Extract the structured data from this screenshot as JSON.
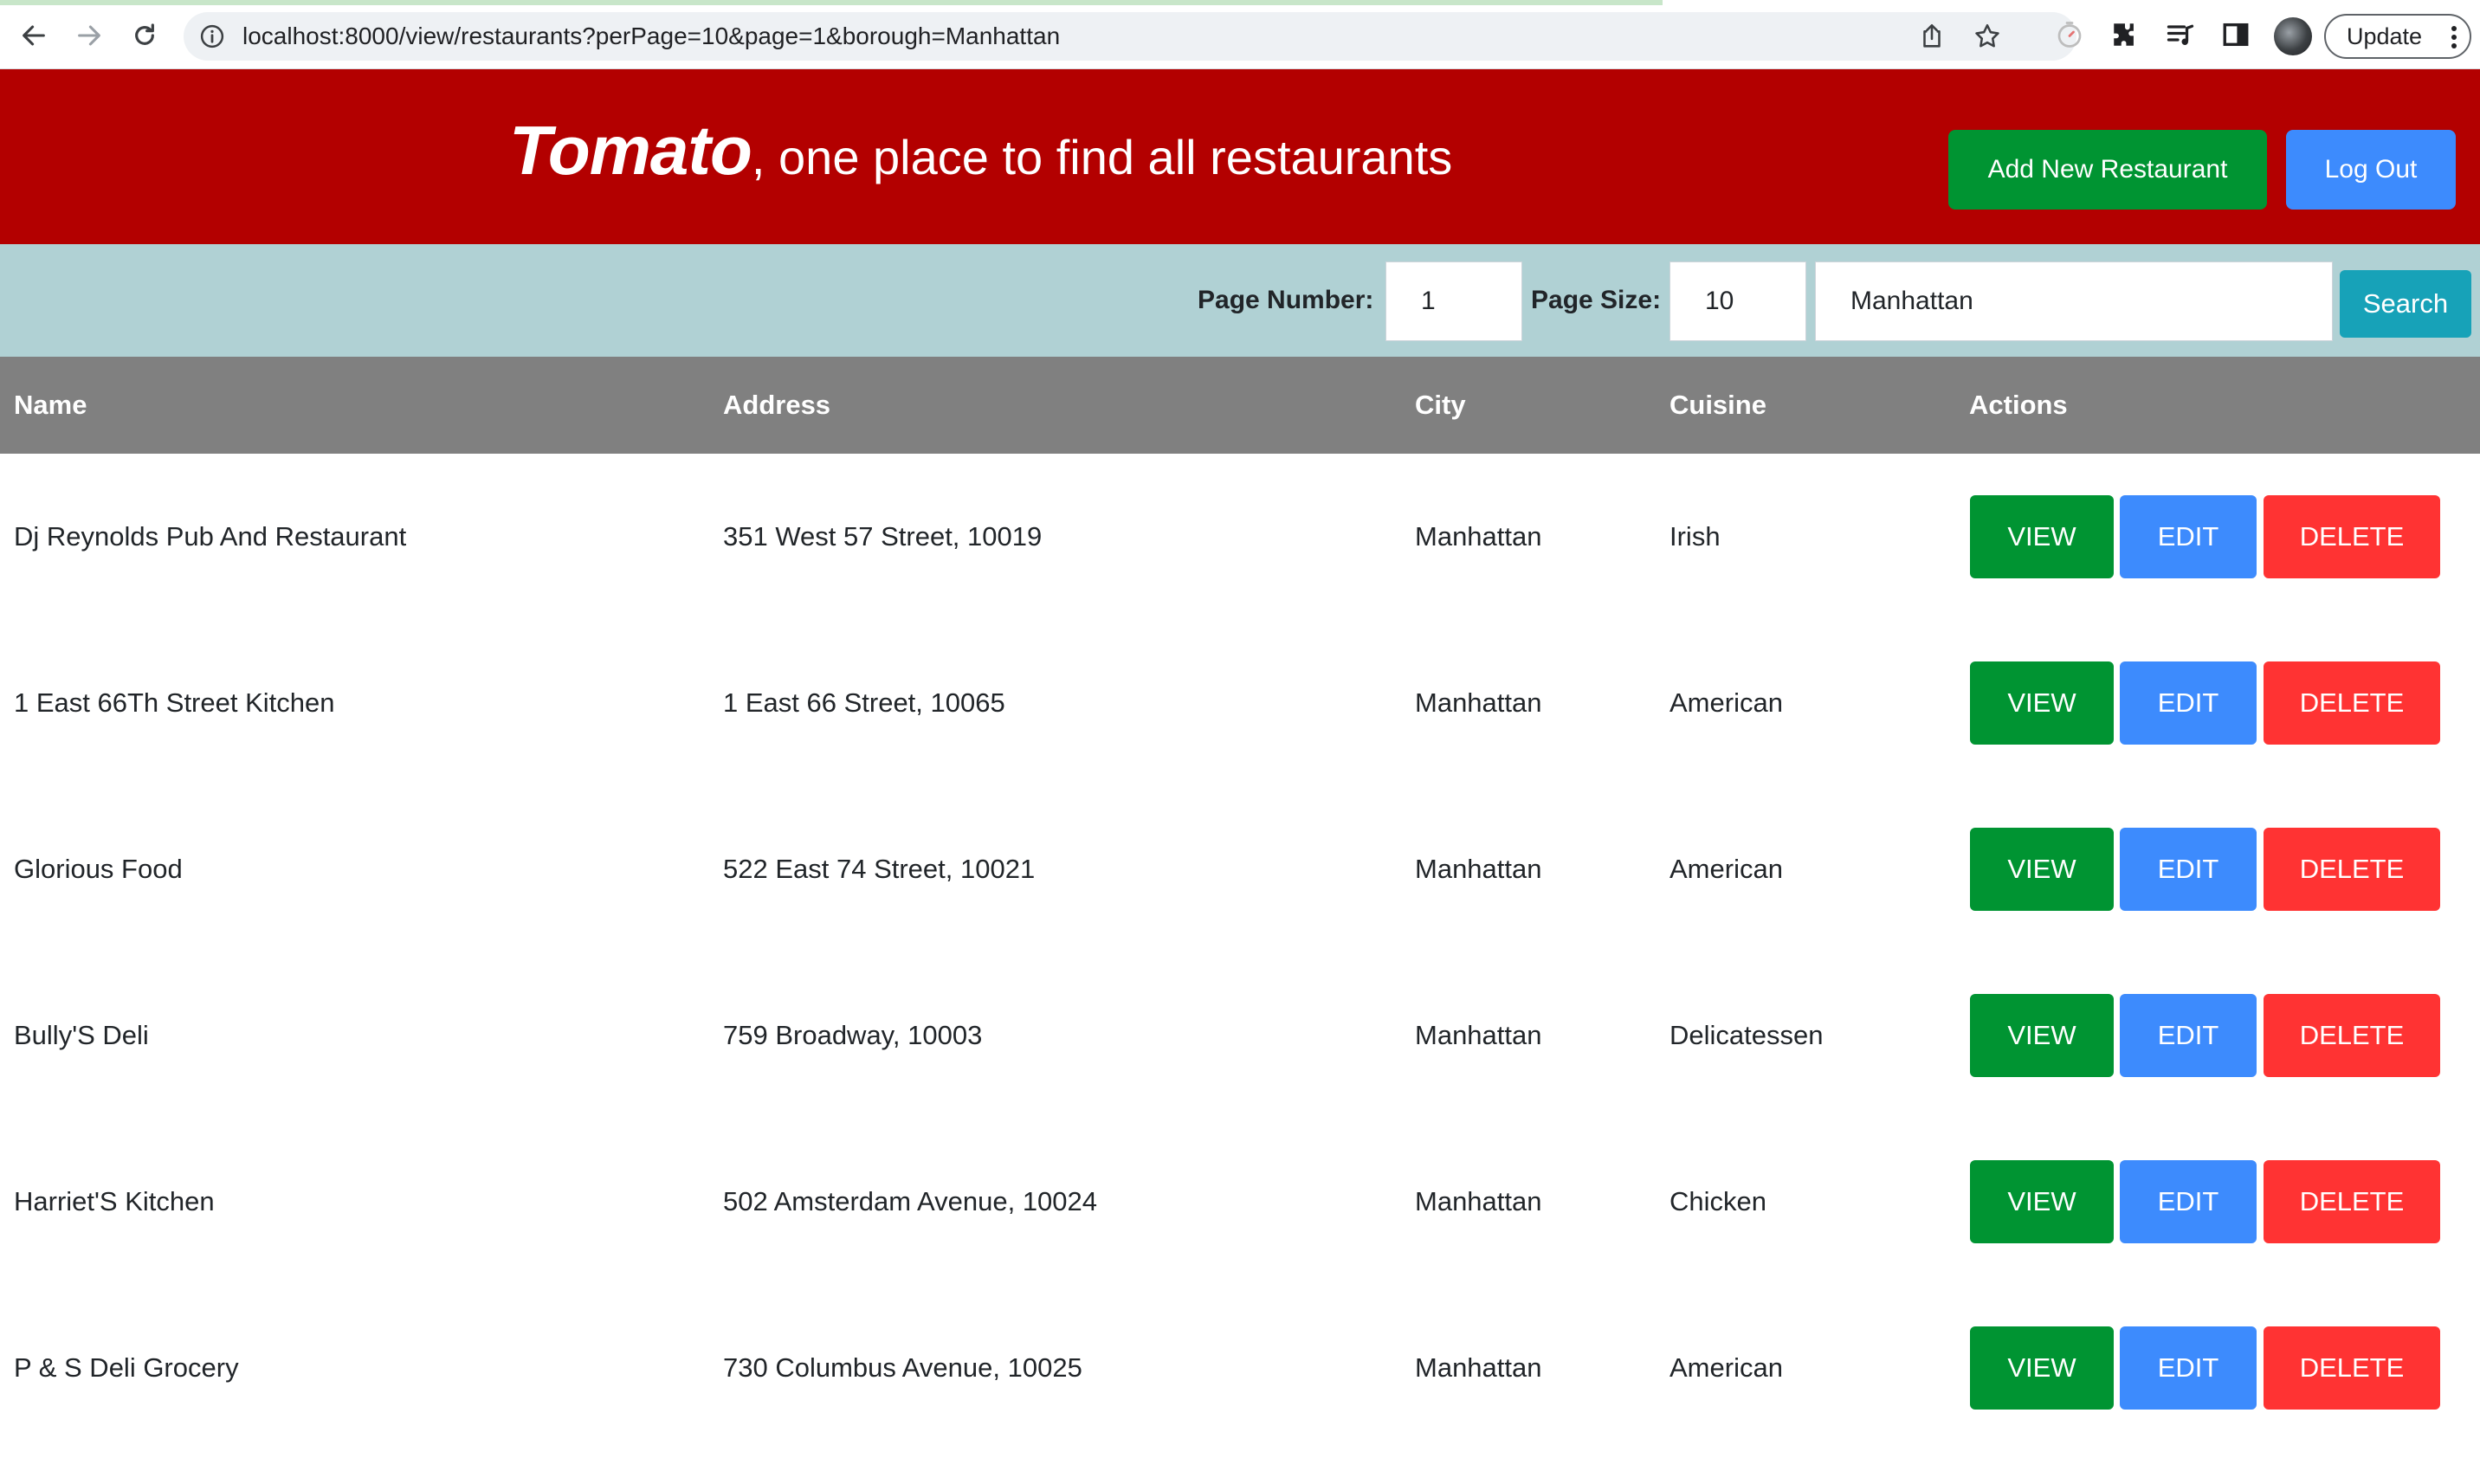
{
  "browser": {
    "url": "localhost:8000/view/restaurants?perPage=10&page=1&borough=Manhattan",
    "update_label": "Update"
  },
  "header": {
    "brand": "Tomato",
    "tagline": ", one place to find all restaurants",
    "add_button": "Add New Restaurant",
    "logout_button": "Log Out",
    "color": "#b30000"
  },
  "search": {
    "page_number_label": "Page Number:",
    "page_number_value": "1",
    "page_size_label": "Page Size:",
    "page_size_value": "10",
    "borough_value": "Manhattan",
    "search_button": "Search"
  },
  "table": {
    "headers": [
      "Name",
      "Address",
      "City",
      "Cuisine",
      "Actions"
    ],
    "rows": [
      {
        "name": "Dj Reynolds Pub And Restaurant",
        "address": "351 West 57 Street, 10019",
        "city": "Manhattan",
        "cuisine": "Irish"
      },
      {
        "name": "1 East 66Th Street Kitchen",
        "address": "1 East 66 Street, 10065",
        "city": "Manhattan",
        "cuisine": "American"
      },
      {
        "name": "Glorious Food",
        "address": "522 East 74 Street, 10021",
        "city": "Manhattan",
        "cuisine": "American"
      },
      {
        "name": "Bully'S Deli",
        "address": "759 Broadway, 10003",
        "city": "Manhattan",
        "cuisine": "Delicatessen"
      },
      {
        "name": "Harriet'S Kitchen",
        "address": "502 Amsterdam Avenue, 10024",
        "city": "Manhattan",
        "cuisine": "Chicken"
      },
      {
        "name": "P & S Deli Grocery",
        "address": "730 Columbus Avenue, 10025",
        "city": "Manhattan",
        "cuisine": "American"
      }
    ],
    "actions": {
      "view": "VIEW",
      "edit": "EDIT",
      "delete": "DELETE"
    }
  }
}
